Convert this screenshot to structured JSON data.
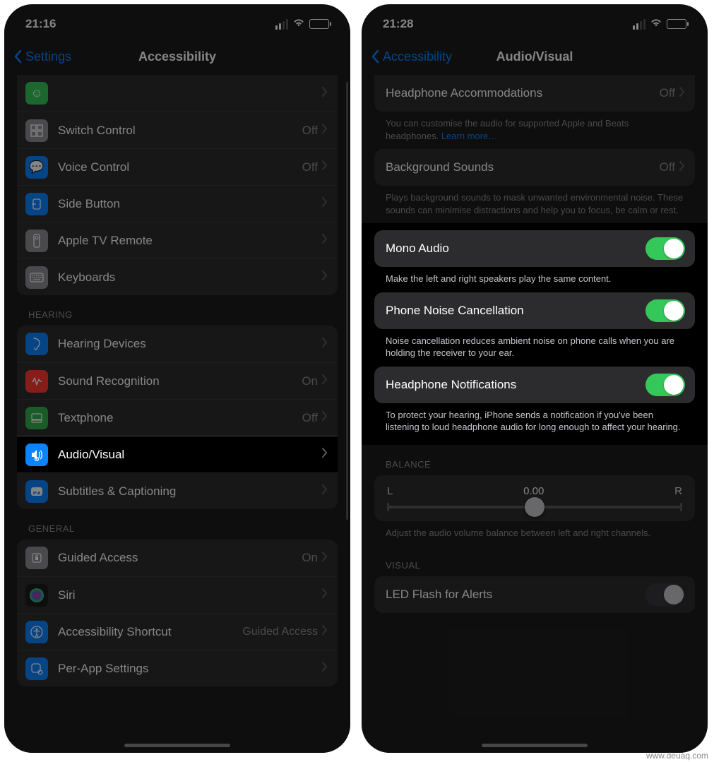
{
  "watermark": "www.deuaq.com",
  "left": {
    "status": {
      "time": "21:16"
    },
    "nav": {
      "back": "Settings",
      "title": "Accessibility"
    },
    "trunc_row": {
      "label": ""
    },
    "group1": [
      {
        "icon": "switch-control-icon",
        "color": "#8e8e93",
        "label": "Switch Control",
        "value": "Off"
      },
      {
        "icon": "voice-control-icon",
        "color": "#0a84ff",
        "label": "Voice Control",
        "value": "Off"
      },
      {
        "icon": "side-button-icon",
        "color": "#0a84ff",
        "label": "Side Button",
        "value": ""
      },
      {
        "icon": "apple-tv-remote-icon",
        "color": "#8e8e93",
        "label": "Apple TV Remote",
        "value": ""
      },
      {
        "icon": "keyboards-icon",
        "color": "#8e8e93",
        "label": "Keyboards",
        "value": ""
      }
    ],
    "hearing_header": "HEARING",
    "group2": [
      {
        "icon": "hearing-devices-icon",
        "color": "#0a84ff",
        "label": "Hearing Devices",
        "value": ""
      },
      {
        "icon": "sound-recognition-icon",
        "color": "#ff3b30",
        "label": "Sound Recognition",
        "value": "On"
      },
      {
        "icon": "textphone-icon",
        "color": "#30b14c",
        "label": "Textphone",
        "value": "Off"
      },
      {
        "icon": "audio-visual-icon",
        "color": "#0a84ff",
        "label": "Audio/Visual",
        "value": "",
        "highlight": true
      },
      {
        "icon": "subtitles-icon",
        "color": "#0a84ff",
        "label": "Subtitles & Captioning",
        "value": ""
      }
    ],
    "general_header": "GENERAL",
    "group3": [
      {
        "icon": "guided-access-icon",
        "color": "#8e8e93",
        "label": "Guided Access",
        "value": "On"
      },
      {
        "icon": "siri-icon",
        "color": "#1c1c1e",
        "label": "Siri",
        "value": ""
      },
      {
        "icon": "accessibility-shortcut-icon",
        "color": "#0a84ff",
        "label": "Accessibility Shortcut",
        "value": "Guided Access"
      },
      {
        "icon": "per-app-settings-icon",
        "color": "#0a84ff",
        "label": "Per-App Settings",
        "value": ""
      }
    ]
  },
  "right": {
    "status": {
      "time": "21:28"
    },
    "nav": {
      "back": "Accessibility",
      "title": "Audio/Visual"
    },
    "headphone_accom": {
      "label": "Headphone Accommodations",
      "value": "Off"
    },
    "headphone_accom_footer_1": "You can customise the audio for supported Apple and Beats headphones. ",
    "headphone_accom_footer_link": "Learn more…",
    "bg_sounds": {
      "label": "Background Sounds",
      "value": "Off"
    },
    "bg_sounds_footer": "Plays background sounds to mask unwanted environmental noise. These sounds can minimise distractions and help you to focus, be calm or rest.",
    "mono": {
      "label": "Mono Audio",
      "on": true
    },
    "mono_footer": "Make the left and right speakers play the same content.",
    "noise": {
      "label": "Phone Noise Cancellation",
      "on": true
    },
    "noise_footer": "Noise cancellation reduces ambient noise on phone calls when you are holding the receiver to your ear.",
    "hp_notif": {
      "label": "Headphone Notifications",
      "on": true
    },
    "hp_notif_footer": "To protect your hearing, iPhone sends a notification if you've been listening to loud headphone audio for long enough to affect your hearing.",
    "balance_header": "BALANCE",
    "balance": {
      "left": "L",
      "value": "0.00",
      "right": "R"
    },
    "balance_footer": "Adjust the audio volume balance between left and right channels.",
    "visual_header": "VISUAL",
    "led": {
      "label": "LED Flash for Alerts",
      "on": false
    }
  }
}
